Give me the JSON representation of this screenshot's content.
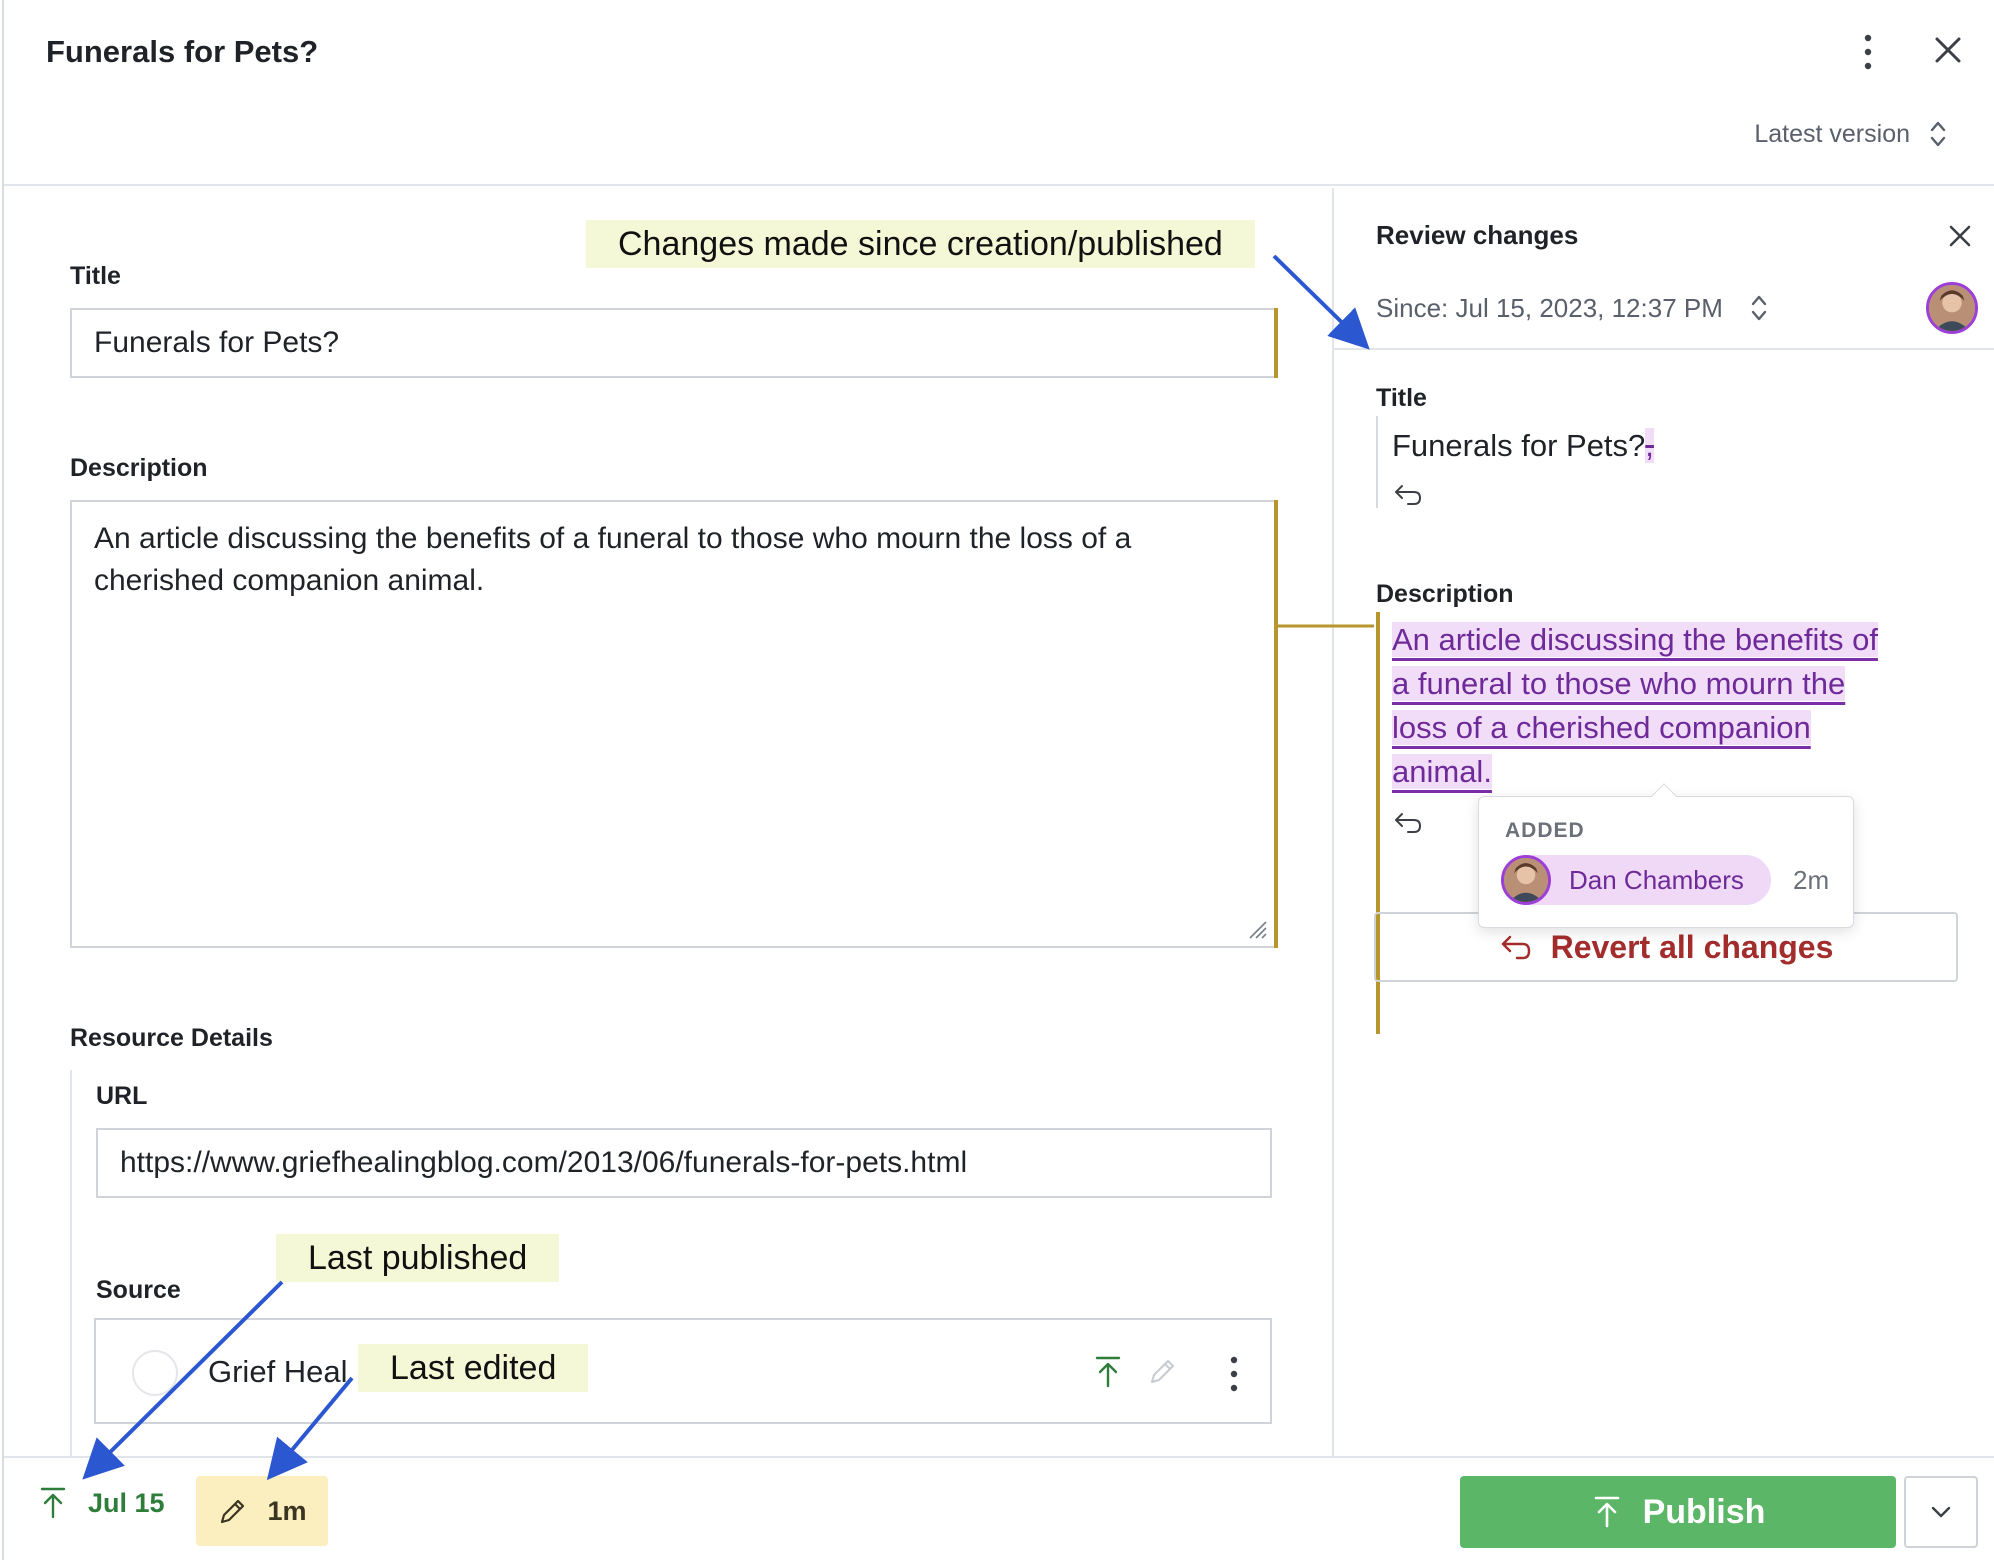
{
  "header": {
    "title": "Funerals for Pets?",
    "version_label": "Latest version"
  },
  "form": {
    "title_label": "Title",
    "title_value": "Funerals for Pets?",
    "description_label": "Description",
    "description_value": "An article discussing the benefits of a funeral to those who mourn the loss of a cherished companion animal.",
    "resource_details_label": "Resource Details",
    "url_label": "URL",
    "url_value": "https://www.griefhealingblog.com/2013/06/funerals-for-pets.html",
    "source_label": "Source",
    "source_name": "Grief Heal"
  },
  "annotations": {
    "changes": "Changes made since creation/published",
    "last_published": "Last published",
    "last_edited": "Last edited"
  },
  "review": {
    "title": "Review changes",
    "since": "Since: Jul 15, 2023, 12:37 PM",
    "title_label": "Title",
    "title_value": "Funerals for Pets?",
    "title_removed": ",",
    "description_label": "Description",
    "desc_lines": [
      "An article discussing the benefits of",
      "a funeral to those who mourn the",
      "loss of a cherished companion",
      "animal."
    ],
    "tooltip": {
      "heading": "ADDED",
      "user": "Dan Chambers",
      "time": "2m"
    },
    "revert_label": "Revert all changes"
  },
  "footer": {
    "published_date": "Jul 15",
    "edited_ago": "1m",
    "publish_label": "Publish"
  },
  "colors": {
    "publish_green": "#5cb667",
    "published_text": "#2f7d3a",
    "change_bar": "#b8962e",
    "added_bg": "#f1ddf8",
    "added_text": "#6e2a99",
    "revert_red": "#a32c2c",
    "edited_bg": "#fbeebf"
  }
}
